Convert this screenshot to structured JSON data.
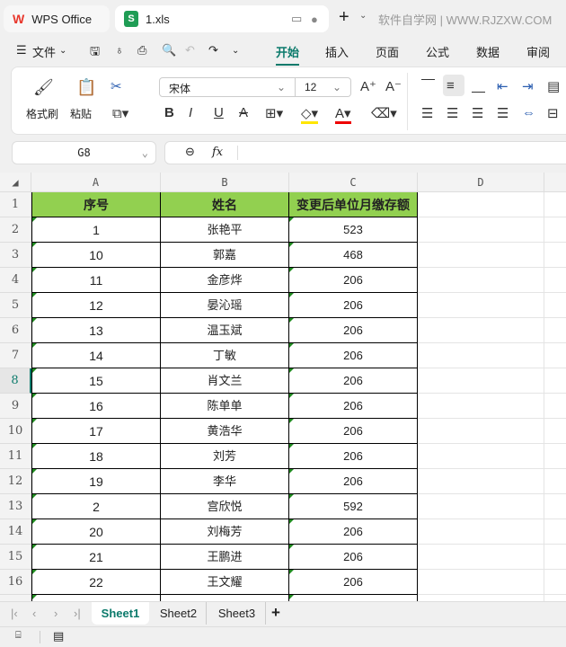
{
  "title_bar": {
    "app_tab": "WPS Office",
    "file_tab": "1.xls",
    "file_icon_letter": "S",
    "watermark": "软件自学网 | WWW.RJZXW.COM"
  },
  "menu": {
    "file": "文件",
    "tabs": [
      "开始",
      "插入",
      "页面",
      "公式",
      "数据",
      "审阅"
    ],
    "active_tab": "开始"
  },
  "ribbon": {
    "format_painter": "格式刷",
    "paste": "粘贴",
    "font_name": "宋体",
    "font_size": "12"
  },
  "formula_bar": {
    "cell_ref": "G8",
    "fx": "fx",
    "value": ""
  },
  "columns": [
    "A",
    "B",
    "C",
    "D"
  ],
  "headers": [
    "序号",
    "姓名",
    "变更后单位月缴存额"
  ],
  "rows": [
    [
      "1",
      "张艳平",
      "523"
    ],
    [
      "10",
      "郭嘉",
      "468"
    ],
    [
      "11",
      "金彦烨",
      "206"
    ],
    [
      "12",
      "晏沁瑶",
      "206"
    ],
    [
      "13",
      "温玉斌",
      "206"
    ],
    [
      "14",
      "丁敏",
      "206"
    ],
    [
      "15",
      "肖文兰",
      "206"
    ],
    [
      "16",
      "陈单单",
      "206"
    ],
    [
      "17",
      "黄浩华",
      "206"
    ],
    [
      "18",
      "刘芳",
      "206"
    ],
    [
      "19",
      "李华",
      "206"
    ],
    [
      "2",
      "宫欣悦",
      "592"
    ],
    [
      "20",
      "刘梅芳",
      "206"
    ],
    [
      "21",
      "王鹏进",
      "206"
    ],
    [
      "22",
      "王文耀",
      "206"
    ]
  ],
  "row_numbers": [
    "1",
    "2",
    "3",
    "4",
    "5",
    "6",
    "7",
    "8",
    "9",
    "10",
    "11",
    "12",
    "13",
    "14",
    "15",
    "16"
  ],
  "selected_row": "8",
  "sheets": [
    "Sheet1",
    "Sheet2",
    "Sheet3"
  ],
  "active_sheet": "Sheet1",
  "colors": {
    "header_fill": "#92d050",
    "accent": "#0b7a6b",
    "wps_red": "#e8372c",
    "sheet_green": "#1f9d55"
  }
}
